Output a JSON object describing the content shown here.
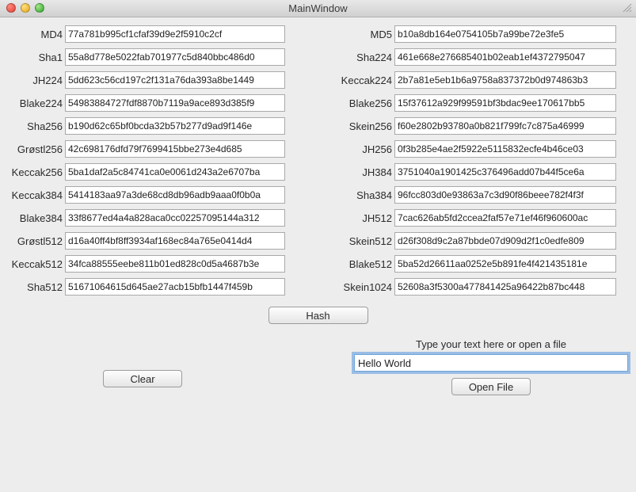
{
  "window": {
    "title": "MainWindow"
  },
  "leftHashes": [
    {
      "label": "MD4",
      "value": "77a781b995cf1cfaf39d9e2f5910c2cf"
    },
    {
      "label": "Sha1",
      "value": "55a8d778e5022fab701977c5d840bbc486d0"
    },
    {
      "label": "JH224",
      "value": "5dd623c56cd197c2f131a76da393a8be1449"
    },
    {
      "label": "Blake224",
      "value": "54983884727fdf8870b7119a9ace893d385f9"
    },
    {
      "label": "Sha256",
      "value": "b190d62c65bf0bcda32b57b277d9ad9f146e"
    },
    {
      "label": "Grøstl256",
      "value": "42c698176dfd79f7699415bbe273e4d685"
    },
    {
      "label": "Keccak256",
      "value": "5ba1daf2a5c84741ca0e0061d243a2e6707ba"
    },
    {
      "label": "Keccak384",
      "value": "5414183aa97a3de68cd8db96adb9aaa0f0b0a"
    },
    {
      "label": "Blake384",
      "value": "33f8677ed4a4a828aca0cc02257095144a312"
    },
    {
      "label": "Grøstl512",
      "value": "d16a40ff4bf8ff3934af168ec84a765e0414d4"
    },
    {
      "label": "Keccak512",
      "value": "34fca88555eebe811b01ed828c0d5a4687b3e"
    },
    {
      "label": "Sha512",
      "value": "51671064615d645ae27acb15bfb1447f459b"
    }
  ],
  "rightHashes": [
    {
      "label": "MD5",
      "value": "b10a8db164e0754105b7a99be72e3fe5"
    },
    {
      "label": "Sha224",
      "value": "461e668e276685401b02eab1ef4372795047"
    },
    {
      "label": "Keccak224",
      "value": "2b7a81e5eb1b6a9758a837372b0d974863b3"
    },
    {
      "label": "Blake256",
      "value": "15f37612a929f99591bf3bdac9ee170617bb5"
    },
    {
      "label": "Skein256",
      "value": "f60e2802b93780a0b821f799fc7c875a46999"
    },
    {
      "label": "JH256",
      "value": "0f3b285e4ae2f5922e5115832ecfe4b46ce03"
    },
    {
      "label": "JH384",
      "value": "3751040a1901425c376496add07b44f5ce6a"
    },
    {
      "label": "Sha384",
      "value": "96fcc803d0e93863a7c3d90f86beee782f4f3f"
    },
    {
      "label": "JH512",
      "value": "7cac626ab5fd2ccea2faf57e71ef46f960600ac"
    },
    {
      "label": "Skein512",
      "value": "d26f308d9c2a87bbde07d909d2f1c0edfe809"
    },
    {
      "label": "Blake512",
      "value": "5ba52d26611aa0252e5b891fe4f421435181e"
    },
    {
      "label": "Skein1024",
      "value": "52608a3f5300a477841425a96422b87bc448"
    }
  ],
  "buttons": {
    "hash": "Hash",
    "clear": "Clear",
    "open": "Open File"
  },
  "inputArea": {
    "hint": "Type your text here or open a file",
    "value": "Hello World"
  }
}
